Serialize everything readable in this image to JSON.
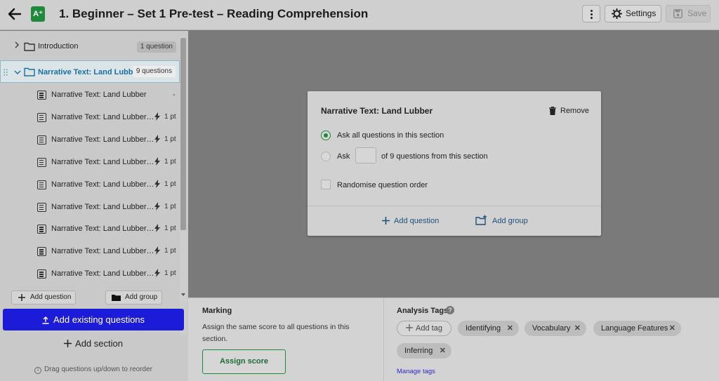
{
  "header": {
    "title": "1. Beginner – Set 1 Pre-test – Reading Comprehension",
    "app_icon_text": "A⁺",
    "settings_label": "Settings",
    "save_label": "Save"
  },
  "sidebar": {
    "intro": {
      "label": "Introduction",
      "badge": "1 question"
    },
    "section": {
      "label": "Narrative Text: Land Lubber",
      "badge": "9 questions"
    },
    "items": [
      {
        "label": "Narrative Text: Land Lubber",
        "points": "-"
      },
      {
        "label": "Narrative Text: Land Lubber…",
        "points": "1 pt"
      },
      {
        "label": "Narrative Text: Land Lubber…",
        "points": "1 pt"
      },
      {
        "label": "Narrative Text: Land Lubber…",
        "points": "1 pt"
      },
      {
        "label": "Narrative Text: Land Lubber…",
        "points": "1 pt"
      },
      {
        "label": "Narrative Text: Land Lubber…",
        "points": "1 pt"
      },
      {
        "label": "Narrative Text: Land Lubber…",
        "points": "1 pt"
      },
      {
        "label": "Narrative Text: Land Lubber…",
        "points": "1 pt"
      },
      {
        "label": "Narrative Text: Land Lubber…",
        "points": "1 pt"
      }
    ],
    "add_question_label": "Add question",
    "add_group_label": "Add group",
    "add_existing_label": "Add existing questions",
    "add_section_label": "Add section",
    "hint": "Drag questions up/down to reorder"
  },
  "card": {
    "title": "Narrative Text: Land Lubber",
    "remove_label": "Remove",
    "option_all": "Ask all questions in this section",
    "option_ask": "Ask",
    "option_ask_suffix": "of 9 questions from this section",
    "randomise_label": "Randomise question order",
    "add_question_label": "Add question",
    "add_group_label": "Add group"
  },
  "marking": {
    "title": "Marking",
    "description": "Assign the same score to all questions in this section.",
    "assign_label": "Assign score"
  },
  "analysis": {
    "title": "Analysis Tags",
    "add_tag_label": "Add tag",
    "tags": [
      "Identifying",
      "Vocabulary",
      "Language Features",
      "Inferring"
    ],
    "manage_label": "Manage tags"
  },
  "colors": {
    "accent_green": "#1f8a3b",
    "primary_blue": "#1b1bd8",
    "selected_blue": "#1b6fa0"
  }
}
